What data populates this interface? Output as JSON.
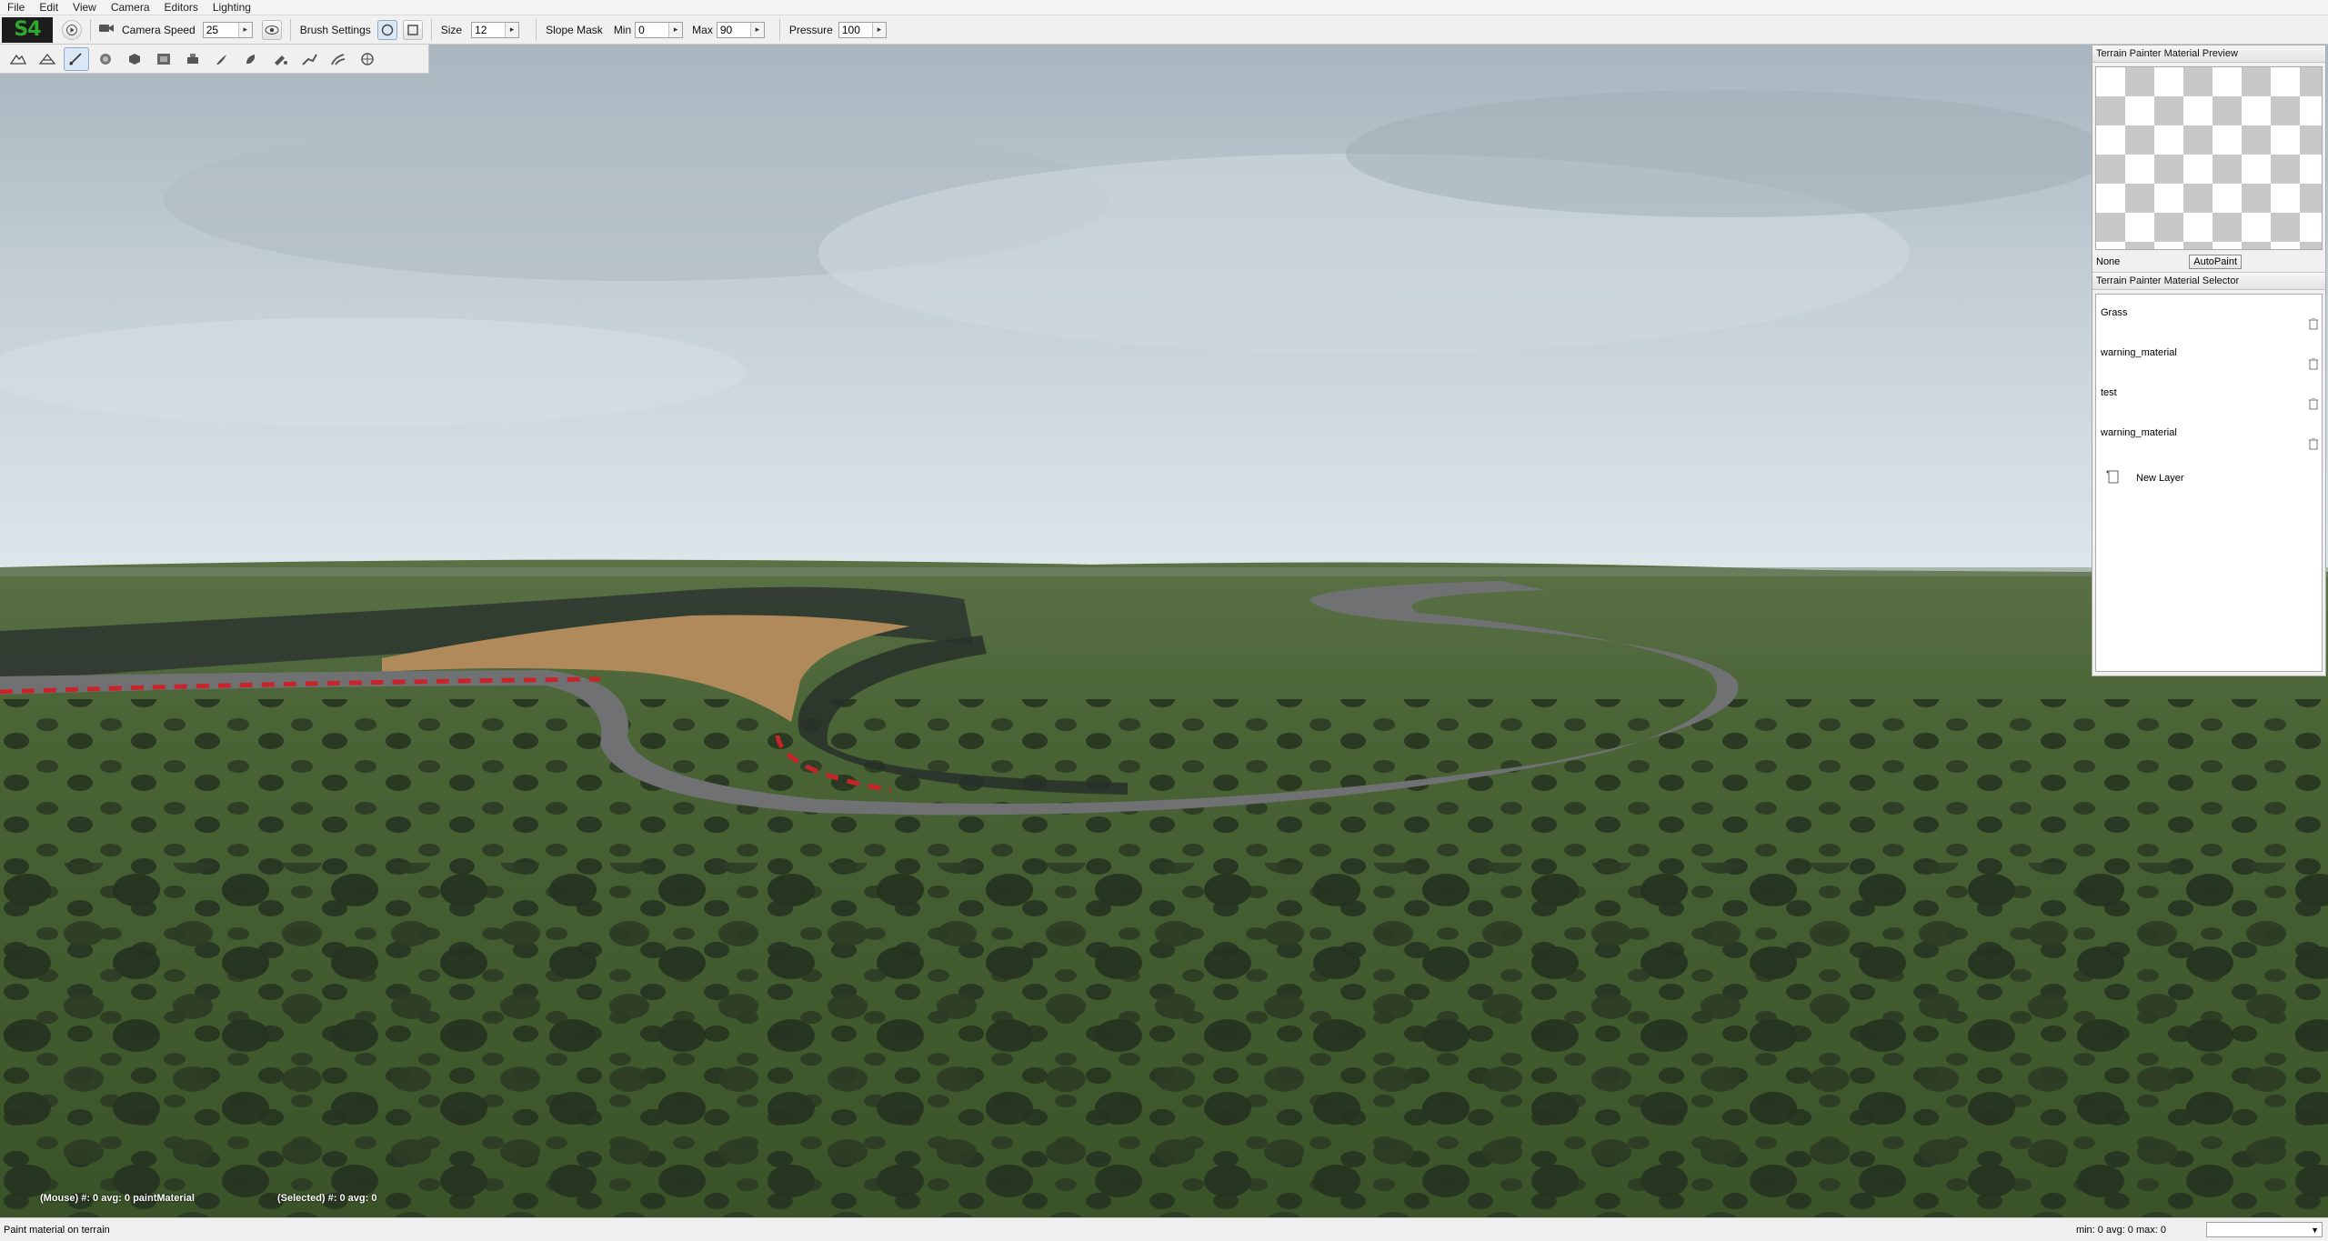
{
  "menu": [
    "File",
    "Edit",
    "View",
    "Camera",
    "Editors",
    "Lighting"
  ],
  "toolbar": {
    "logo_text": "S4",
    "camera_speed_label": "Camera Speed",
    "camera_speed_value": "25",
    "brush_settings_label": "Brush Settings",
    "size_label": "Size",
    "size_value": "12",
    "slope_mask_label": "Slope Mask",
    "min_label": "Min",
    "min_value": "0",
    "max_label": "Max",
    "max_value": "90",
    "pressure_label": "Pressure",
    "pressure_value": "100"
  },
  "brush_tools": [
    "raise-lower-icon",
    "smooth-icon",
    "paint-material-icon",
    "noise-icon",
    "flatten-icon",
    "heightmap-icon",
    "average-icon",
    "grass-icon",
    "tree-icon",
    "fill-icon",
    "fog-icon",
    "road-icon",
    "decal-icon"
  ],
  "viewport": {
    "mouse_readout": "(Mouse) #: 0  avg: 0 paintMaterial",
    "selected_readout": "(Selected) #: 0  avg: 0"
  },
  "preview_panel": {
    "title": "Terrain Painter Material Preview",
    "material_name": "None",
    "autopaint_label": "AutoPaint"
  },
  "selector_panel": {
    "title": "Terrain Painter Material Selector",
    "materials": [
      "Grass",
      "warning_material",
      "test",
      "warning_material"
    ],
    "new_layer_label": "New Layer"
  },
  "status": {
    "left": "Paint material on terrain",
    "right": "min: 0  avg: 0  max: 0"
  },
  "colors": {
    "logo_green": "#2fa82f",
    "sky_top": "#a9b6bf",
    "grass": "#3f5a2a",
    "road": "#707173",
    "dirt": "#b08a5a"
  }
}
